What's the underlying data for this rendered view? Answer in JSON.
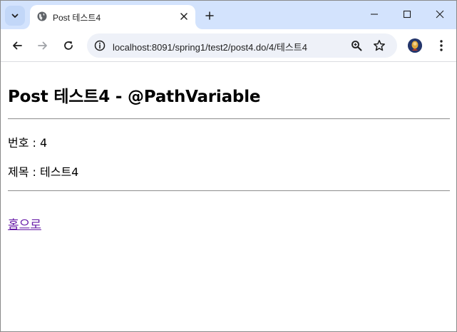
{
  "browser": {
    "tab": {
      "title": "Post 테스트4",
      "favicon": "globe-icon"
    },
    "address": {
      "url": "localhost:8091/spring1/test2/post4.do/4/테스트4"
    },
    "icons": {
      "tab_search": "chevron-down-icon",
      "tab_close": "close-icon",
      "new_tab": "plus-icon",
      "minimize": "minimize-icon",
      "maximize": "maximize-icon",
      "close": "close-icon",
      "back": "arrow-left-icon",
      "forward": "arrow-right-icon",
      "reload": "reload-icon",
      "site_info": "info-icon",
      "zoom": "zoom-in-icon",
      "bookmark": "star-icon",
      "profile": "avatar",
      "menu": "more-vert-icon"
    },
    "colors": {
      "tabstrip": "#d3e3fd",
      "omnibox": "#eef1f8",
      "link_visited": "#681da8"
    }
  },
  "page": {
    "heading": "Post 테스트4 - @PathVariable",
    "number_line": "번호 : 4",
    "title_line": "제목 : 테스트4",
    "home_link": "홈으로"
  }
}
